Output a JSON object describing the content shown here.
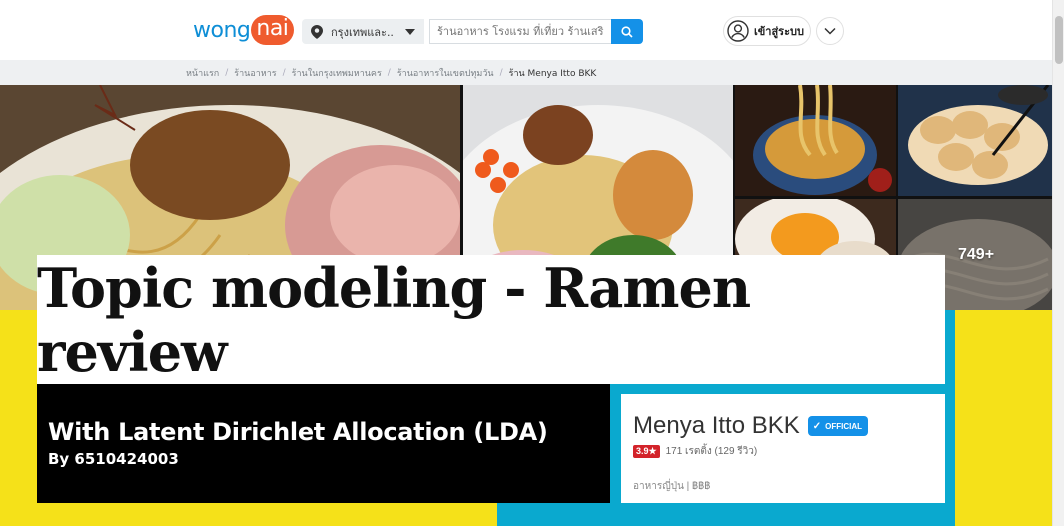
{
  "header": {
    "logo_part1": "wong",
    "logo_part2": "nai",
    "location": "กรุงเทพและ...",
    "search_placeholder": "ร้านอาหาร โรงแรม ที่เที่ยว ร้านเสริมสว...",
    "login_label": "เข้าสู่ระบบ"
  },
  "breadcrumb": [
    "หน้าแรก",
    "ร้านอาหาร",
    "ร้านในกรุงเทพมหานคร",
    "ร้านอาหารในเขตปทุมวัน",
    "ร้าน Menya Itto BKK"
  ],
  "gallery": {
    "more_count": "749+"
  },
  "slide": {
    "title": "Topic modeling - Ramen review",
    "subtitle": "With Latent Dirichlet Allocation (LDA)",
    "author": "By 6510424003"
  },
  "restaurant": {
    "name": "Menya Itto BKK",
    "badge": "OFFICIAL",
    "score": "3.9",
    "reviews": "171 เรตติ้ง (129 รีวิว)",
    "category": "อาหารญี่ปุ่น | ฿฿฿"
  },
  "colors": {
    "accent_blue": "#1491e8",
    "brand_orange": "#ef5b2e",
    "slide_yellow": "#f5e119",
    "slide_cyan": "#0aa9cf",
    "rating_red": "#d3232a"
  }
}
